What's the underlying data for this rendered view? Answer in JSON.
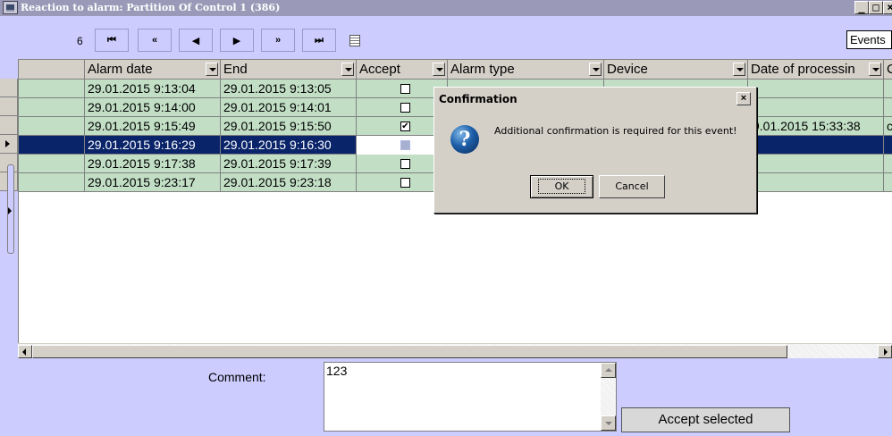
{
  "window": {
    "title": "Reaction to alarm: Partition  Of Control 1 (386)",
    "minimize": "_",
    "maximize": "□",
    "close": "×"
  },
  "toolbar": {
    "page_num": "6",
    "first": "⏮",
    "prev_page": "«",
    "prev": "◀",
    "next": "▶",
    "next_page": "»",
    "last": "⏭"
  },
  "events_button": "Events",
  "grid": {
    "columns": [
      "Alarm date",
      "End",
      "Accept",
      "Alarm type",
      "Device",
      "Date of processin",
      "C"
    ],
    "rows": [
      {
        "alarm_date": "29.01.2015 9:13:04",
        "end": "29.01.2015 9:13:05",
        "accept": "",
        "alarm_type": "",
        "device": "",
        "date_processing": "",
        "c": ""
      },
      {
        "alarm_date": "29.01.2015 9:14:00",
        "end": "29.01.2015 9:14:01",
        "accept": "",
        "alarm_type": "",
        "device": "",
        "date_processing": "",
        "c": ""
      },
      {
        "alarm_date": "29.01.2015 9:15:49",
        "end": "29.01.2015 9:15:50",
        "accept": "✔",
        "alarm_type": "",
        "device": "",
        "date_processing": "9.01.2015 15:33:38",
        "c": "c"
      },
      {
        "alarm_date": "29.01.2015 9:16:29",
        "end": "29.01.2015 9:16:30",
        "accept": "",
        "alarm_type": "",
        "device": "",
        "date_processing": "",
        "c": ""
      },
      {
        "alarm_date": "29.01.2015 9:17:38",
        "end": "29.01.2015 9:17:39",
        "accept": "",
        "alarm_type": "",
        "device": "",
        "date_processing": "",
        "c": ""
      },
      {
        "alarm_date": "29.01.2015 9:23:17",
        "end": "29.01.2015 9:23:18",
        "accept": "",
        "alarm_type": "",
        "device": "",
        "date_processing": "",
        "c": ""
      }
    ]
  },
  "comment": {
    "label": "Comment:",
    "value": "123"
  },
  "accept_selected_button": "Accept selected",
  "dialog": {
    "title": "Confirmation",
    "close": "×",
    "icon": "?",
    "message": "Additional confirmation is required for this event!",
    "ok": "OK",
    "cancel": "Cancel"
  }
}
